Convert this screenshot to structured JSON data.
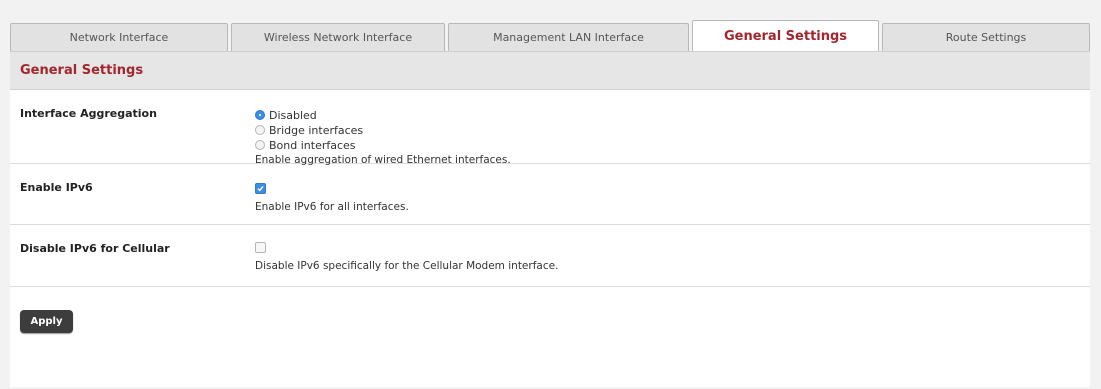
{
  "tabs": [
    {
      "label": "Network Interface",
      "active": false
    },
    {
      "label": "Wireless Network Interface",
      "active": false
    },
    {
      "label": "Management LAN Interface",
      "active": false
    },
    {
      "label": "General Settings",
      "active": true
    },
    {
      "label": "Route Settings",
      "active": false
    }
  ],
  "section": {
    "title": "General Settings"
  },
  "interface_aggregation": {
    "label": "Interface Aggregation",
    "options": [
      {
        "label": "Disabled",
        "selected": true
      },
      {
        "label": "Bridge interfaces",
        "selected": false
      },
      {
        "label": "Bond interfaces",
        "selected": false
      }
    ],
    "help": "Enable aggregation of wired Ethernet interfaces."
  },
  "enable_ipv6": {
    "label": "Enable IPv6",
    "checked": true,
    "help": "Enable IPv6 for all interfaces."
  },
  "disable_ipv6_cellular": {
    "label": "Disable IPv6 for Cellular",
    "checked": false,
    "help": "Disable IPv6 specifically for the Cellular Modem interface."
  },
  "apply": {
    "label": "Apply"
  },
  "colors": {
    "accent_red": "#a3262e",
    "checked_blue": "#3a8ee6",
    "button_dark": "#3d3d3d"
  }
}
